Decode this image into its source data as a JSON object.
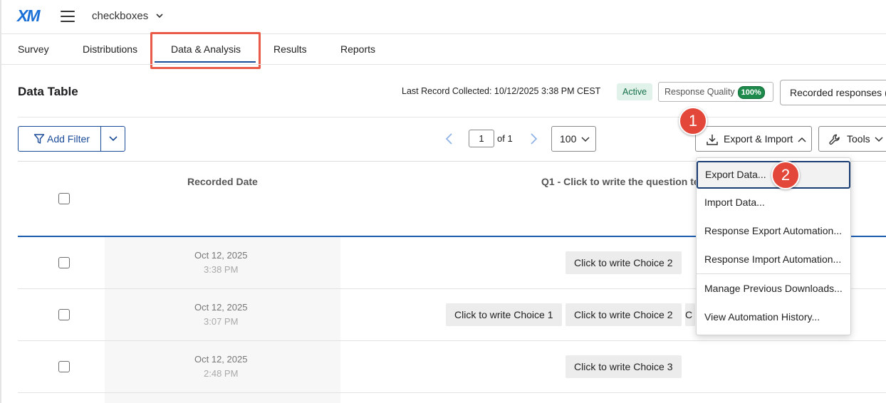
{
  "app": {
    "logo": "XM",
    "project_name": "checkboxes"
  },
  "tabs": [
    {
      "label": "Survey"
    },
    {
      "label": "Distributions"
    },
    {
      "label": "Data & Analysis",
      "active": true
    },
    {
      "label": "Results"
    },
    {
      "label": "Reports"
    }
  ],
  "header": {
    "title": "Data Table",
    "last_record": "Last Record Collected: 10/12/2025 3:38 PM CEST",
    "status_badge": "Active",
    "response_quality_label": "Response Quality",
    "response_quality_value": "100%",
    "recorded_responses_label": "Recorded responses ("
  },
  "toolbar": {
    "add_filter_label": "Add Filter",
    "page_current": "1",
    "page_of": "of 1",
    "per_page": "100",
    "export_import_label": "Export & Import",
    "tools_label": "Tools"
  },
  "steps": {
    "one": "1",
    "two": "2"
  },
  "table": {
    "columns": [
      "Recorded Date",
      "Q1 - Click to write the question text"
    ],
    "rows": [
      {
        "date": "Oct 12, 2025",
        "time": "3:38 PM",
        "choices": [
          "Click to write Choice 2"
        ]
      },
      {
        "date": "Oct 12, 2025",
        "time": "3:07 PM",
        "choices": [
          "Click to write Choice 1",
          "Click to write Choice 2",
          "C"
        ]
      },
      {
        "date": "Oct 12, 2025",
        "time": "2:48 PM",
        "choices": [
          "Click to write Choice 3"
        ]
      }
    ]
  },
  "export_menu": {
    "items": [
      {
        "label": "Export Data..."
      },
      {
        "label": "Import Data..."
      },
      {
        "label": "Response Export Automation..."
      },
      {
        "label": "Response Import Automation..."
      },
      {
        "label": "Manage Previous Downloads..."
      },
      {
        "label": "View Automation History..."
      }
    ]
  },
  "colors": {
    "accent": "#1a4b99",
    "highlight": "#ea5a48",
    "step_marker": "#e3473a",
    "active_badge_bg": "#e1f2ea",
    "quality_pill": "#1e8a4c"
  },
  "icons": [
    "hamburger-menu-icon",
    "chevron-down-icon",
    "filter-icon",
    "chevron-left-icon",
    "chevron-right-icon",
    "download-icon",
    "chevron-up-icon",
    "wrench-icon"
  ]
}
